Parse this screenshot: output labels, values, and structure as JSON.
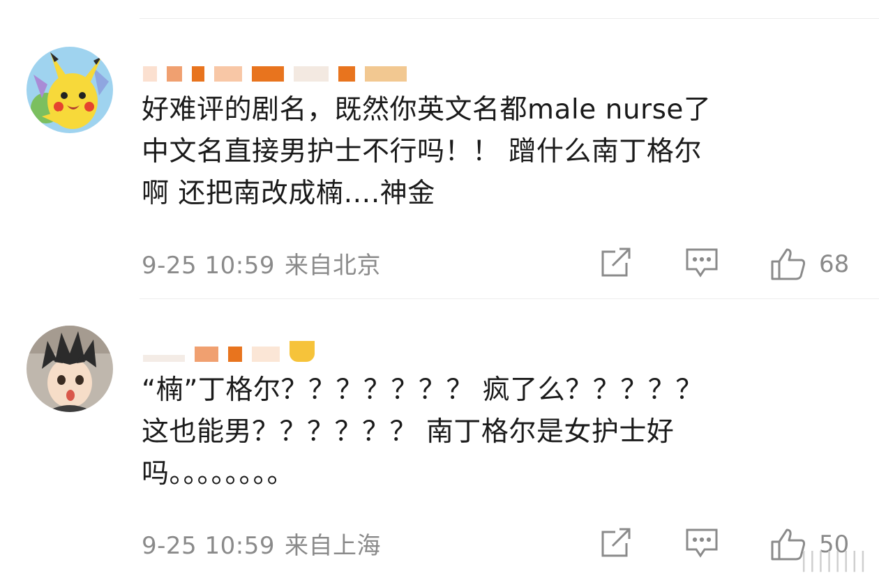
{
  "comments": [
    {
      "text": "好难评的剧名，既然你英文名都male nurse了\n中文名直接男护士不行吗！！ 蹭什么南丁格尔\n啊 还把南改成楠….神金",
      "time": "9-25 10:59",
      "location": "来自北京",
      "likes": "68",
      "avatar_icon": "pikachu-avatar-icon"
    },
    {
      "text": "“楠”丁格尔？？？？？？？ 疯了么？？？？？\n这也能男？？？？？？ 南丁格尔是女护士好\n吗。。。。。。。。",
      "time": "9-25 10:59",
      "location": "来自上海",
      "likes": "50",
      "avatar_icon": "anime-boy-avatar-icon"
    }
  ],
  "icons": {
    "repost": "repost-icon",
    "reply": "comment-icon",
    "like": "thumbs-up-icon"
  },
  "colors": {
    "meta_gray": "#8a8a8a",
    "text": "#1a1a1a",
    "divider": "#ececec"
  },
  "watermark": "||||||||"
}
